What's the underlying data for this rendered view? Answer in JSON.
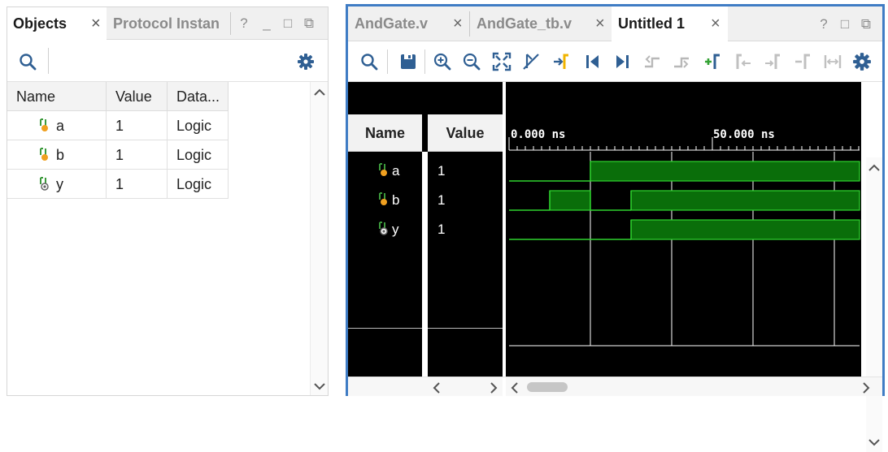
{
  "objects_panel": {
    "tabs": [
      {
        "label": "Objects",
        "active": true,
        "close": "×"
      },
      {
        "label": "Protocol Instan",
        "active": false
      }
    ],
    "window_buttons": {
      "help": "?",
      "minimize": "_",
      "maximize": "□",
      "float": "⧉"
    },
    "columns": [
      "Name",
      "Value",
      "Data..."
    ],
    "rows": [
      {
        "name": "a",
        "value": "1",
        "type": "Logic"
      },
      {
        "name": "b",
        "value": "1",
        "type": "Logic"
      },
      {
        "name": "y",
        "value": "1",
        "type": "Logic"
      }
    ]
  },
  "waveform_panel": {
    "tabs": [
      {
        "label": "AndGate.v",
        "active": false,
        "close": "×"
      },
      {
        "label": "AndGate_tb.v",
        "active": false,
        "close": "×"
      },
      {
        "label": "Untitled 1",
        "active": true,
        "close": "×"
      }
    ],
    "window_buttons": {
      "help": "?",
      "maximize": "□",
      "float": "⧉"
    },
    "toolbar_icons": [
      "search-icon",
      "save-icon",
      "zoom-in-icon",
      "zoom-out-icon",
      "zoom-fit-icon",
      "cursor-off-icon",
      "add-marker-icon",
      "go-to-start-icon",
      "go-to-end-icon",
      "previous-transition-icon",
      "next-transition-icon",
      "add-marker-plus-icon",
      "previous-marker-icon",
      "next-marker-icon",
      "remove-marker-icon",
      "swap-cursors-icon",
      "settings-icon"
    ],
    "columns": {
      "name": "Name",
      "value": "Value"
    },
    "time_labels": [
      "0.000 ns",
      "50.000 ns"
    ],
    "signals": [
      {
        "name": "a",
        "value": "1",
        "transitions": [
          {
            "t": 0,
            "v": 0
          },
          {
            "t": 20,
            "v": 1
          }
        ]
      },
      {
        "name": "b",
        "value": "1",
        "transitions": [
          {
            "t": 0,
            "v": 0
          },
          {
            "t": 10,
            "v": 1
          },
          {
            "t": 20,
            "v": 0
          },
          {
            "t": 30,
            "v": 1
          }
        ]
      },
      {
        "name": "y",
        "value": "1",
        "transitions": [
          {
            "t": 0,
            "v": 0
          },
          {
            "t": 30,
            "v": 1
          }
        ]
      }
    ],
    "time_range_ns": [
      0,
      87
    ],
    "colors": {
      "wave": "#2fd42f",
      "wave_fill": "#0a6e0a",
      "background": "#000000",
      "grid": "#ffffff",
      "accent": "#3f7cc4"
    }
  }
}
